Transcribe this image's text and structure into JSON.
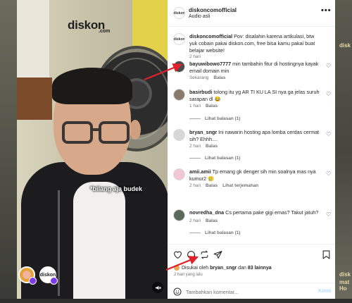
{
  "video": {
    "brand": "diskon",
    "brand_sub": ".com",
    "caption": "*bilang aja budek",
    "collab_avatar_2_text": "diskon"
  },
  "header": {
    "username": "diskoncomofficial",
    "audio": "Audio asli",
    "more": "•••",
    "avatar_text": "diskon"
  },
  "post_caption": {
    "username": "diskoncomofficial",
    "text": "Pov: disalahin karena artikulasi, btw yuk cobain pakai diskon.com, free bisa kamu pakai buat belajar website!",
    "time": "2 hari"
  },
  "comments": [
    {
      "username": "bayuwibowo7777",
      "text": "min tambahin fitur di hostingnya kayak email domain min",
      "time": "Sekarang",
      "reply": "Balas",
      "extra": "",
      "view_replies": "",
      "avatar_color": "#4a4a4a"
    },
    {
      "username": "basirbudi",
      "text": "tolong itu yg AR TI KU LA SI nya ga jelas suruh sarapan dl 😂",
      "time": "1 hari",
      "reply": "Balas",
      "extra": "",
      "view_replies": "Lihat balasan (1)",
      "avatar_color": "#8a7a6a"
    },
    {
      "username": "bryan_sngr",
      "text": "Ini nawarin hosting apa lomba cerdas cermat sih? Ehhh....",
      "time": "2 hari",
      "reply": "Balas",
      "extra": "",
      "view_replies": "Lihat balasan (1)",
      "avatar_color": "#d8d8d8"
    },
    {
      "username": "amii.amii",
      "text": "Tp emang gk denger sih min soalnya mas nya kumur2 🥲",
      "time": "2 hari",
      "reply": "Balas",
      "extra": "Lihat terjemahan",
      "view_replies": "",
      "avatar_color": "#f2c6d4"
    },
    {
      "username": "novredha_dna",
      "text": "Cs pertama pake gigi emas? Takut jatuh?",
      "time": "2 hari",
      "reply": "Balas",
      "extra": "",
      "view_replies": "Lihat balasan (1)",
      "avatar_color": "#5a6a5a"
    }
  ],
  "actions": {
    "liked_prefix": "Disukai oleh",
    "liked_user": "bryan_sngr",
    "liked_mid": "dan",
    "liked_others": "83 lainnya",
    "time": "2 hari yang lalu",
    "comment_placeholder": "Tambahkan komentar...",
    "post_label": "Kirim"
  },
  "background": {
    "right_labels": [
      "disk",
      "mat Ho",
      "disk"
    ]
  },
  "colors": {
    "annotation_arrow": "#e0202a",
    "post_button": "#b3dbff",
    "secondary_text": "#737373"
  }
}
